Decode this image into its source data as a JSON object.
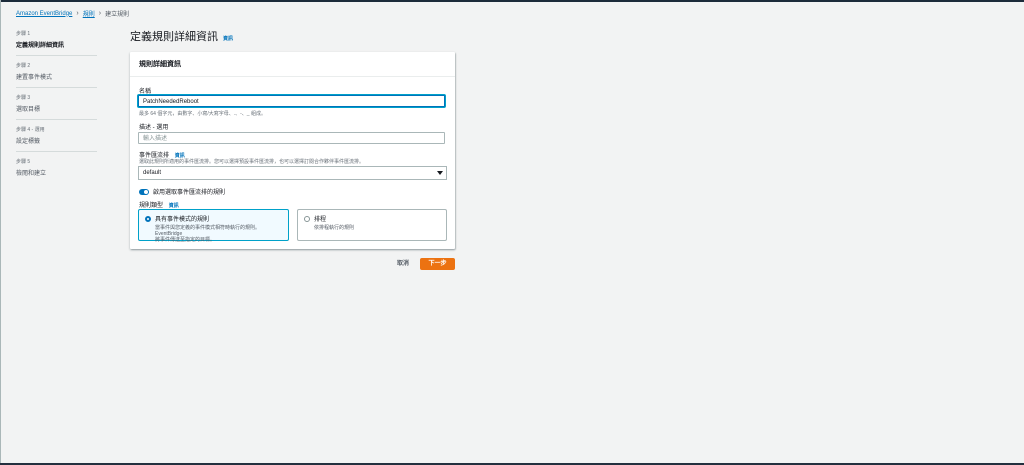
{
  "breadcrumb": {
    "root": "Amazon EventBridge",
    "rules": "規則",
    "current": "建立規則"
  },
  "steps": [
    {
      "num": "步驟 1",
      "title": "定義規則詳細資訊",
      "active": true
    },
    {
      "num": "步驟 2",
      "title": "建置事件模式"
    },
    {
      "num": "步驟 3",
      "title": "選取目標"
    },
    {
      "num": "步驟 4 - 選用",
      "title": "設定標籤"
    },
    {
      "num": "步驟 5",
      "title": "檢閱和建立"
    }
  ],
  "page": {
    "title": "定義規則詳細資訊",
    "info": "資訊"
  },
  "card": {
    "header": "規則詳細資訊",
    "name": {
      "label": "名稱",
      "value": "PatchNeededReboot",
      "hint": "最多 64 個字元，由數字、小寫/大寫字母、.、-、_ 組成。"
    },
    "description": {
      "label": "描述 - 選用",
      "placeholder": "輸入描述"
    },
    "event_bus": {
      "label": "事件匯流排",
      "info": "資訊",
      "desc": "選取此規則所適用的事件匯流排。您可以選擇預設事件匯流排，也可以選擇訂閱合作夥伴事件匯流排。",
      "value": "default"
    },
    "toggle_label": "啟用選取事件匯流排的規則",
    "rule_type": {
      "label": "規則類型",
      "info": "資訊",
      "option1": {
        "title": "具有事件模式的規則",
        "desc1": "當事件與您定義的事件模式相符時執行的規則。EventBridge",
        "desc2": "將事件傳送至指定的目標。"
      },
      "option2": {
        "title": "排程",
        "desc1": "依排程執行的規則"
      }
    }
  },
  "actions": {
    "cancel": "取消",
    "next": "下一步"
  }
}
